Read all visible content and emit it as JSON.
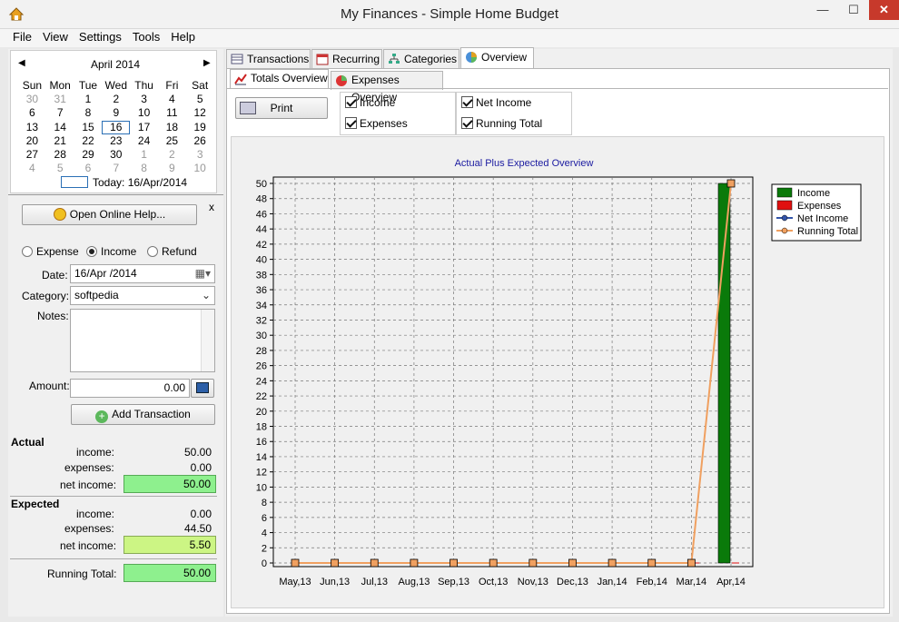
{
  "window": {
    "title": "My Finances - Simple Home Budget",
    "min": "—",
    "max": "☐",
    "close": "✕"
  },
  "menu": [
    "File",
    "View",
    "Settings",
    "Tools",
    "Help"
  ],
  "calendar": {
    "month": "April 2014",
    "days": [
      "Sun",
      "Mon",
      "Tue",
      "Wed",
      "Thu",
      "Fri",
      "Sat"
    ],
    "weeks": [
      [
        "30",
        "31",
        "1",
        "2",
        "3",
        "4",
        "5"
      ],
      [
        "6",
        "7",
        "8",
        "9",
        "10",
        "11",
        "12"
      ],
      [
        "13",
        "14",
        "15",
        "16",
        "17",
        "18",
        "19"
      ],
      [
        "20",
        "21",
        "22",
        "23",
        "24",
        "25",
        "26"
      ],
      [
        "27",
        "28",
        "29",
        "30",
        "1",
        "2",
        "3"
      ],
      [
        "4",
        "5",
        "6",
        "7",
        "8",
        "9",
        "10"
      ]
    ],
    "today": "Today: 16/Apr/2014"
  },
  "help": {
    "button": "Open Online Help...",
    "close": "x"
  },
  "form": {
    "type_options": [
      "Expense",
      "Income",
      "Refund"
    ],
    "selected_type": "Income",
    "date_label": "Date:",
    "date_value": "16/Apr /2014",
    "category_label": "Category:",
    "category_value": "softpedia",
    "notes_label": "Notes:",
    "notes_value": "",
    "amount_label": "Amount:",
    "amount_value": "0.00",
    "add_button": "Add Transaction"
  },
  "summary": {
    "actual_heading": "Actual",
    "expected_heading": "Expected",
    "income_label": "income:",
    "expenses_label": "expenses:",
    "net_label": "net income:",
    "actual": {
      "income": "50.00",
      "expenses": "0.00",
      "net": "50.00"
    },
    "expected": {
      "income": "0.00",
      "expenses": "44.50",
      "net": "5.50"
    },
    "running_label": "Running Total:",
    "running_value": "50.00"
  },
  "tabs": [
    "Transactions",
    "Recurring",
    "Categories",
    "Overview"
  ],
  "active_tab": "Overview",
  "subtabs": [
    "Totals Overview",
    "Expenses Overview"
  ],
  "print_button": "Print",
  "checkboxes": [
    {
      "label": "Income",
      "checked": true
    },
    {
      "label": "Expenses",
      "checked": true
    },
    {
      "label": "Net Income",
      "checked": true
    },
    {
      "label": "Running Total",
      "checked": true
    }
  ],
  "colors": {
    "income": "#0a7a0a",
    "expenses": "#e01010",
    "net": "#3355aa",
    "running": "#f0a060",
    "title": "#1a1aa0"
  },
  "chart_data": {
    "type": "bar",
    "title": "Actual Plus Expected Overview",
    "categories": [
      "May,13",
      "Jun,13",
      "Jul,13",
      "Aug,13",
      "Sep,13",
      "Oct,13",
      "Nov,13",
      "Dec,13",
      "Jan,14",
      "Feb,14",
      "Mar,14",
      "Apr,14"
    ],
    "ylim": [
      0,
      50
    ],
    "yticks": [
      0,
      2,
      4,
      6,
      8,
      10,
      12,
      14,
      16,
      18,
      20,
      22,
      24,
      26,
      28,
      30,
      32,
      34,
      36,
      38,
      40,
      42,
      44,
      46,
      48,
      50
    ],
    "grid": true,
    "legend_position": "right",
    "series": [
      {
        "name": "Income",
        "type": "bar",
        "values": [
          0,
          0,
          0,
          0,
          0,
          0,
          0,
          0,
          0,
          0,
          0,
          50
        ]
      },
      {
        "name": "Expenses",
        "type": "bar",
        "values": [
          0,
          0,
          0,
          0,
          0,
          0,
          0,
          0,
          0,
          0,
          0,
          0
        ]
      },
      {
        "name": "Net Income",
        "type": "line",
        "values": [
          0,
          0,
          0,
          0,
          0,
          0,
          0,
          0,
          0,
          0,
          0,
          50
        ]
      },
      {
        "name": "Running Total",
        "type": "line",
        "values": [
          0,
          0,
          0,
          0,
          0,
          0,
          0,
          0,
          0,
          0,
          0,
          50
        ]
      }
    ]
  }
}
